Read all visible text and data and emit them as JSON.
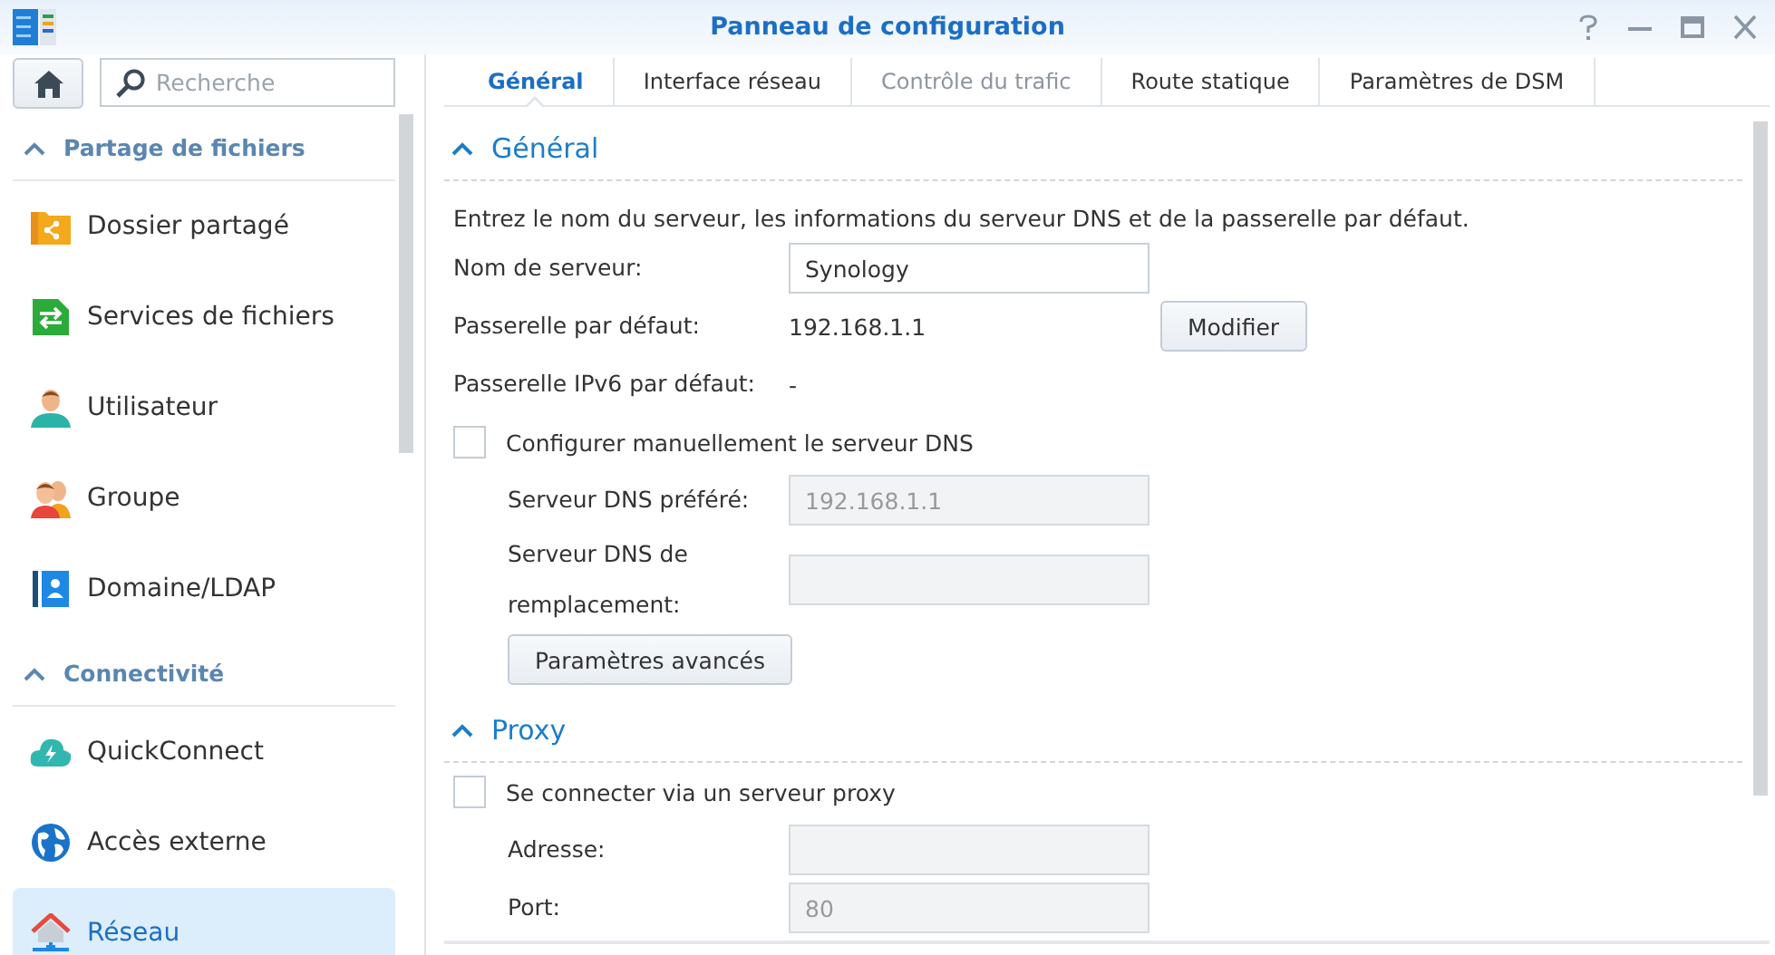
{
  "window": {
    "title": "Panneau de configuration"
  },
  "sidebar": {
    "search": {
      "placeholder": "Recherche"
    },
    "sections": [
      {
        "title": "Partage de fichiers",
        "expanded": true,
        "items": [
          {
            "label": "Dossier partagé",
            "selected": false
          },
          {
            "label": "Services de fichiers",
            "selected": false
          },
          {
            "label": "Utilisateur",
            "selected": false
          },
          {
            "label": "Groupe",
            "selected": false
          },
          {
            "label": "Domaine/LDAP",
            "selected": false
          }
        ]
      },
      {
        "title": "Connectivité",
        "expanded": true,
        "items": [
          {
            "label": "QuickConnect",
            "selected": false
          },
          {
            "label": "Accès externe",
            "selected": false
          },
          {
            "label": "Réseau",
            "selected": true
          }
        ]
      }
    ]
  },
  "tabs": [
    {
      "label": "Général",
      "selected": true,
      "disabled": false
    },
    {
      "label": "Interface réseau",
      "selected": false,
      "disabled": false
    },
    {
      "label": "Contrôle du trafic",
      "selected": false,
      "disabled": true
    },
    {
      "label": "Route statique",
      "selected": false,
      "disabled": false
    },
    {
      "label": "Paramètres de DSM",
      "selected": false,
      "disabled": false
    }
  ],
  "sections": [
    {
      "title": "Général",
      "expanded": true,
      "description": "Entrez le nom du serveur, les informations du serveur DNS et de la passerelle par défaut.",
      "rows": [
        {
          "kind": "field",
          "label": "Nom de serveur:",
          "value": "Synology",
          "disabled": false
        },
        {
          "kind": "value",
          "label": "Passerelle par défaut:",
          "value": "192.168.1.1",
          "button": "Modifier"
        },
        {
          "kind": "value",
          "label": "Passerelle IPv6 par défaut:",
          "value": "-"
        },
        {
          "kind": "checkbox",
          "label": "Configurer manuellement le serveur DNS",
          "checked": false,
          "children": [
            {
              "kind": "field",
              "label": "Serveur DNS préféré:",
              "value": "192.168.1.1",
              "disabled": true
            },
            {
              "kind": "field",
              "label": "Serveur DNS de remplacement:",
              "disabled": true
            },
            {
              "kind": "button",
              "label": "Paramètres avancés"
            }
          ]
        }
      ]
    },
    {
      "title": "Proxy",
      "expanded": true,
      "rows": [
        {
          "kind": "checkbox",
          "label": "Se connecter via un serveur proxy",
          "checked": false,
          "children": [
            {
              "kind": "field",
              "label": "Adresse:",
              "disabled": true
            },
            {
              "kind": "field",
              "label": "Port:",
              "value": "80",
              "disabled": true
            }
          ]
        }
      ]
    }
  ]
}
